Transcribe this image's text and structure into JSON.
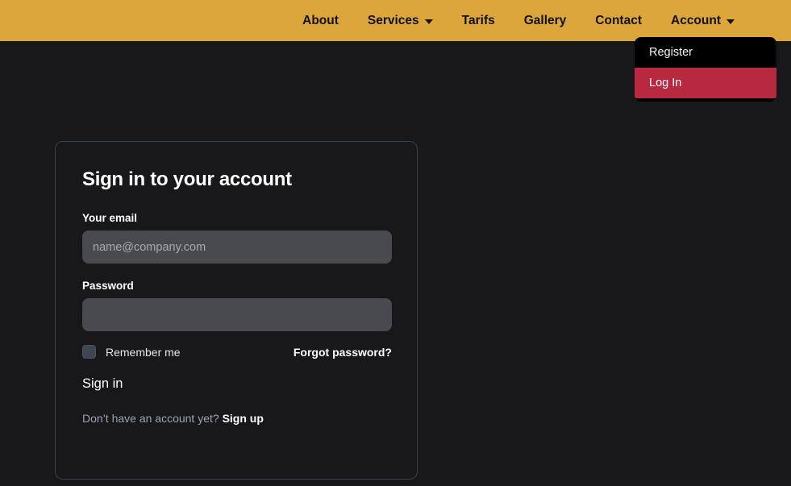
{
  "navbar": {
    "background_color": "#dda63a",
    "items": [
      {
        "label": "About",
        "has_caret": false
      },
      {
        "label": "Services",
        "has_caret": true
      },
      {
        "label": "Tarifs",
        "has_caret": false
      },
      {
        "label": "Gallery",
        "has_caret": false
      },
      {
        "label": "Contact",
        "has_caret": false
      },
      {
        "label": "Account",
        "has_caret": true
      }
    ]
  },
  "account_dropdown": {
    "open": true,
    "highlight_color": "#b8293f",
    "items": [
      {
        "label": "Register",
        "active": false
      },
      {
        "label": "Log In",
        "active": true
      }
    ]
  },
  "signin_card": {
    "title": "Sign in to your account",
    "email": {
      "label": "Your email",
      "placeholder": "name@company.com",
      "value": ""
    },
    "password": {
      "label": "Password",
      "placeholder": "",
      "value": ""
    },
    "remember_me": {
      "label": "Remember me",
      "checked": false
    },
    "forgot_password_label": "Forgot password?",
    "submit_label": "Sign in",
    "signup_prompt": "Don’t have an account yet?",
    "signup_link_label": "Sign up"
  },
  "theme": {
    "page_background": "#18181b",
    "card_background": "#18181b",
    "card_border": "#394050",
    "input_background": "#494950",
    "checkbox_color": "#3f4553",
    "accent_gold": "#dda63a",
    "accent_red": "#b8293f",
    "muted_text": "#9ca3af"
  }
}
